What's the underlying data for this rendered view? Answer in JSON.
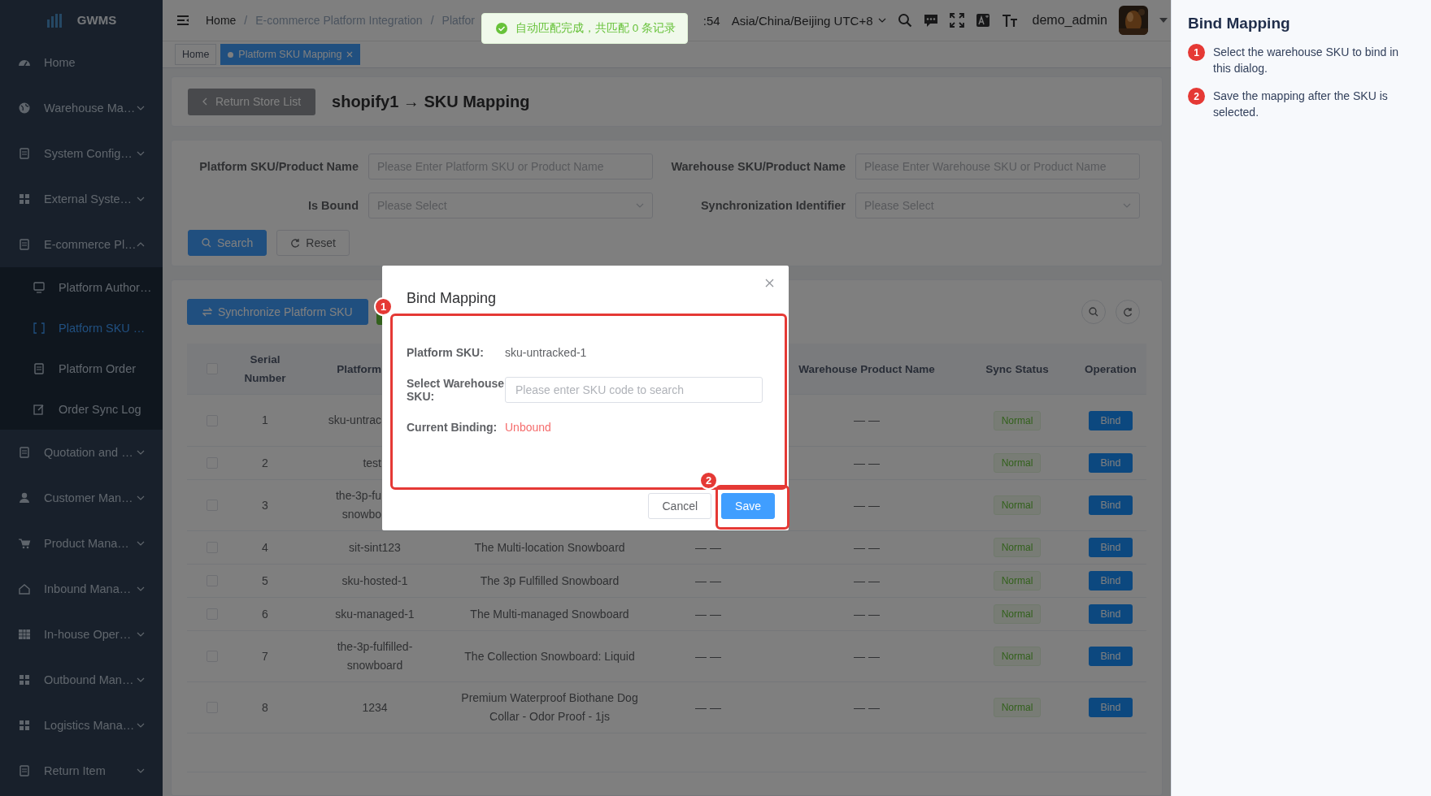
{
  "sidebar": {
    "logo": "GWMS",
    "items": [
      {
        "label": "Home",
        "kind": "link"
      },
      {
        "label": "Warehouse Ma…",
        "kind": "group",
        "expanded": false
      },
      {
        "label": "System Config…",
        "kind": "group",
        "expanded": false
      },
      {
        "label": "External Syste…",
        "kind": "group",
        "expanded": false
      },
      {
        "label": "E-commerce Pl…",
        "kind": "group",
        "expanded": true,
        "children": [
          {
            "label": "Platform Author…",
            "selected": false
          },
          {
            "label": "Platform SKU …",
            "selected": true
          },
          {
            "label": "Platform Order",
            "selected": false
          },
          {
            "label": "Order Sync Log",
            "selected": false
          }
        ]
      },
      {
        "label": "Quotation and …",
        "kind": "group",
        "expanded": false
      },
      {
        "label": "Customer Man…",
        "kind": "group",
        "expanded": false
      },
      {
        "label": "Product Mana…",
        "kind": "group",
        "expanded": false
      },
      {
        "label": "Inbound Mana…",
        "kind": "group",
        "expanded": false
      },
      {
        "label": "In-house Oper…",
        "kind": "group",
        "expanded": false
      },
      {
        "label": "Outbound Man…",
        "kind": "group",
        "expanded": false
      },
      {
        "label": "Logistics Mana…",
        "kind": "group",
        "expanded": false
      },
      {
        "label": "Return Item",
        "kind": "group",
        "expanded": false
      }
    ]
  },
  "topbar": {
    "separator": "/",
    "breadcrumb": [
      "Home",
      "E-commerce Platform Integration",
      "Platfor"
    ],
    "time": ":54",
    "timezone": "Asia/China/Beijing UTC+8",
    "user": "demo_admin"
  },
  "toast": {
    "message": "自动匹配完成，共匹配 0 条记录"
  },
  "tabs": [
    {
      "label": "Home",
      "selected": false
    },
    {
      "label": "Platform SKU Mapping",
      "selected": true
    }
  ],
  "page_header": {
    "back_button": "Return Store List",
    "title": "shopify1 → SKU Mapping"
  },
  "filters": [
    {
      "label": "Platform SKU/Product Name",
      "kind": "input",
      "placeholder": "Please Enter Platform SKU or Product Name"
    },
    {
      "label": "Warehouse SKU/Product Name",
      "kind": "input",
      "placeholder": "Please Enter Warehouse SKU or Product Name"
    },
    {
      "label": "Is Bound",
      "kind": "select",
      "placeholder": "Please Select"
    },
    {
      "label": "Synchronization Identifier",
      "kind": "select",
      "placeholder": "Please Select"
    }
  ],
  "filter_buttons": {
    "search": "Search",
    "reset": "Reset"
  },
  "toolbar": {
    "sync_button": "Synchronize Platform SKU"
  },
  "table": {
    "select_all": {
      "checked": false
    },
    "columns": {
      "serial_number": "Serial Number",
      "column_3": "Platform",
      "warehouse_product_name": "Warehouse Product Name",
      "sync_status": "Sync Status",
      "operation": "Operation"
    },
    "rows": [
      {
        "checked": false,
        "serial_number": "1",
        "column_3": "sku-untrac",
        "warehouse_product_name": "— —",
        "sync_status": "Normal",
        "operation": "Bind"
      },
      {
        "checked": false,
        "serial_number": "2",
        "column_3": "test",
        "warehouse_product_name": "— —",
        "sync_status": "Normal",
        "operation": "Bind"
      },
      {
        "checked": false,
        "serial_number": "3",
        "column_3": "the-3p-fu\nsnowbo",
        "warehouse_product_name": "— —",
        "sync_status": "Normal",
        "operation": "Bind"
      },
      {
        "checked": false,
        "serial_number": "4",
        "column_3": "sit-sint123",
        "column_4": "The Multi-location Snowboard",
        "column_5": "— —",
        "warehouse_product_name": "— —",
        "sync_status": "Normal",
        "operation": "Bind"
      },
      {
        "checked": false,
        "serial_number": "5",
        "column_3": "sku-hosted-1",
        "column_4": "The 3p Fulfilled Snowboard",
        "column_5": "— —",
        "warehouse_product_name": "— —",
        "sync_status": "Normal",
        "operation": "Bind"
      },
      {
        "checked": false,
        "serial_number": "6",
        "column_3": "sku-managed-1",
        "column_4": "The Multi-managed Snowboard",
        "column_5": "— —",
        "warehouse_product_name": "— —",
        "sync_status": "Normal",
        "operation": "Bind"
      },
      {
        "checked": false,
        "serial_number": "7",
        "column_3": "the-3p-fulfilled-snowboard",
        "column_4": "The Collection Snowboard: Liquid",
        "column_5": "— —",
        "warehouse_product_name": "— —",
        "sync_status": "Normal",
        "operation": "Bind"
      },
      {
        "checked": false,
        "serial_number": "8",
        "column_3": "1234",
        "column_4": "Premium Waterproof Biothane Dog Collar - Odor Proof - 1js",
        "column_5": "— —",
        "warehouse_product_name": "— —",
        "sync_status": "Normal",
        "operation": "Bind"
      }
    ]
  },
  "dialog": {
    "title": "Bind Mapping",
    "fields": [
      {
        "label": "Platform SKU:",
        "kind": "text",
        "value": "sku-untracked-1"
      },
      {
        "label": "Select Warehouse SKU:",
        "kind": "input",
        "placeholder": "Please enter SKU code to search"
      },
      {
        "label": "Current Binding:",
        "kind": "status",
        "value": "Unbound"
      }
    ],
    "cancel": "Cancel",
    "save": "Save"
  },
  "annotations": [
    {
      "number": "1"
    },
    {
      "number": "2"
    }
  ],
  "guide_panel": {
    "title": "Bind Mapping",
    "steps": [
      {
        "number": "1",
        "text": "Select the warehouse SKU to bind in this dialog."
      },
      {
        "number": "2",
        "text": "Save the mapping after the SKU is selected."
      }
    ]
  }
}
